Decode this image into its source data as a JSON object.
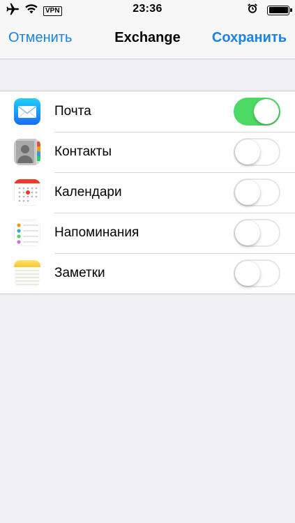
{
  "status_bar": {
    "time": "23:36",
    "vpn": "VPN",
    "battery_level": 1.0
  },
  "nav": {
    "cancel": "Отменить",
    "title": "Exchange",
    "save": "Сохранить",
    "accent_color": "#1a82e2"
  },
  "items": [
    {
      "label": "Почта",
      "icon": "mail-icon",
      "enabled": true
    },
    {
      "label": "Контакты",
      "icon": "contacts-icon",
      "enabled": false
    },
    {
      "label": "Календари",
      "icon": "calendar-icon",
      "enabled": false
    },
    {
      "label": "Напоминания",
      "icon": "reminders-icon",
      "enabled": false
    },
    {
      "label": "Заметки",
      "icon": "notes-icon",
      "enabled": false
    }
  ],
  "toggle_on_color": "#4cd964"
}
